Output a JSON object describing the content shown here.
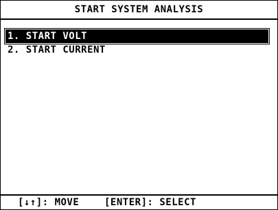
{
  "title": "START SYSTEM ANALYSIS",
  "menu": {
    "items": [
      {
        "label": "1. START VOLT",
        "selected": true
      },
      {
        "label": "2. START CURRENT",
        "selected": false
      }
    ]
  },
  "footer": {
    "move_hint": "[↓↑]: MOVE",
    "select_hint": "[ENTER]: SELECT"
  }
}
